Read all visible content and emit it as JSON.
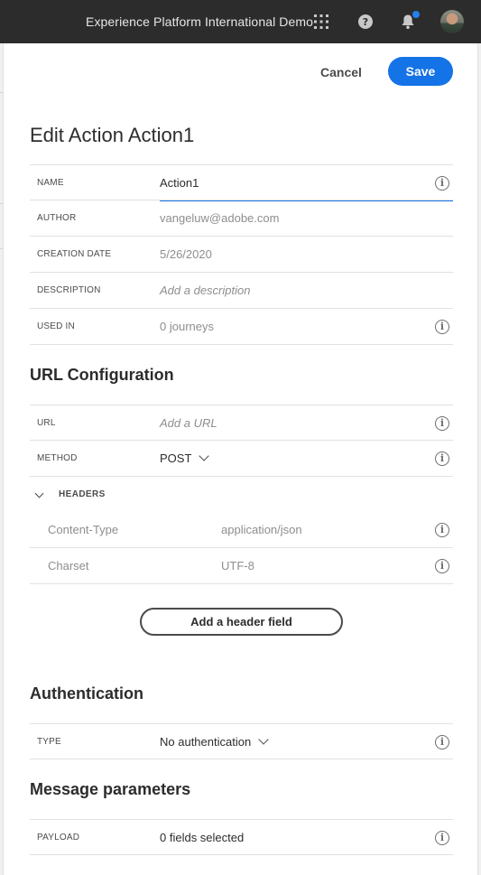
{
  "topbar": {
    "org_name": "Experience Platform International Demo",
    "icons": [
      "apps-grid-icon",
      "help-icon",
      "notification-bell-icon",
      "user-avatar"
    ],
    "bg_color": "#2c2c2c",
    "notification_dot_color": "#2680eb"
  },
  "header": {
    "cancel_label": "Cancel",
    "save_label": "Save",
    "title": "Edit Action Action1",
    "accent_color": "#1473e6"
  },
  "properties": {
    "name_label": "NAME",
    "name_value": "Action1",
    "author_label": "AUTHOR",
    "author_value": "vangeluw@adobe.com",
    "creation_label": "CREATION DATE",
    "creation_value": "5/26/2020",
    "description_label": "DESCRIPTION",
    "description_placeholder": "Add a description",
    "used_in_label": "USED IN",
    "used_in_value": "0 journeys"
  },
  "url_config": {
    "section_title": "URL Configuration",
    "url_label": "URL",
    "url_placeholder": "Add a URL",
    "method_label": "METHOD",
    "method_value": "POST",
    "headers_label": "HEADERS",
    "headers": [
      {
        "key": "Content-Type",
        "value": "application/json"
      },
      {
        "key": "Charset",
        "value": "UTF-8"
      }
    ],
    "add_header_label": "Add a header field"
  },
  "authentication": {
    "section_title": "Authentication",
    "type_label": "TYPE",
    "type_value": "No authentication"
  },
  "message_params": {
    "section_title": "Message parameters",
    "payload_label": "PAYLOAD",
    "payload_value": "0 fields selected"
  },
  "info_glyph": "i"
}
